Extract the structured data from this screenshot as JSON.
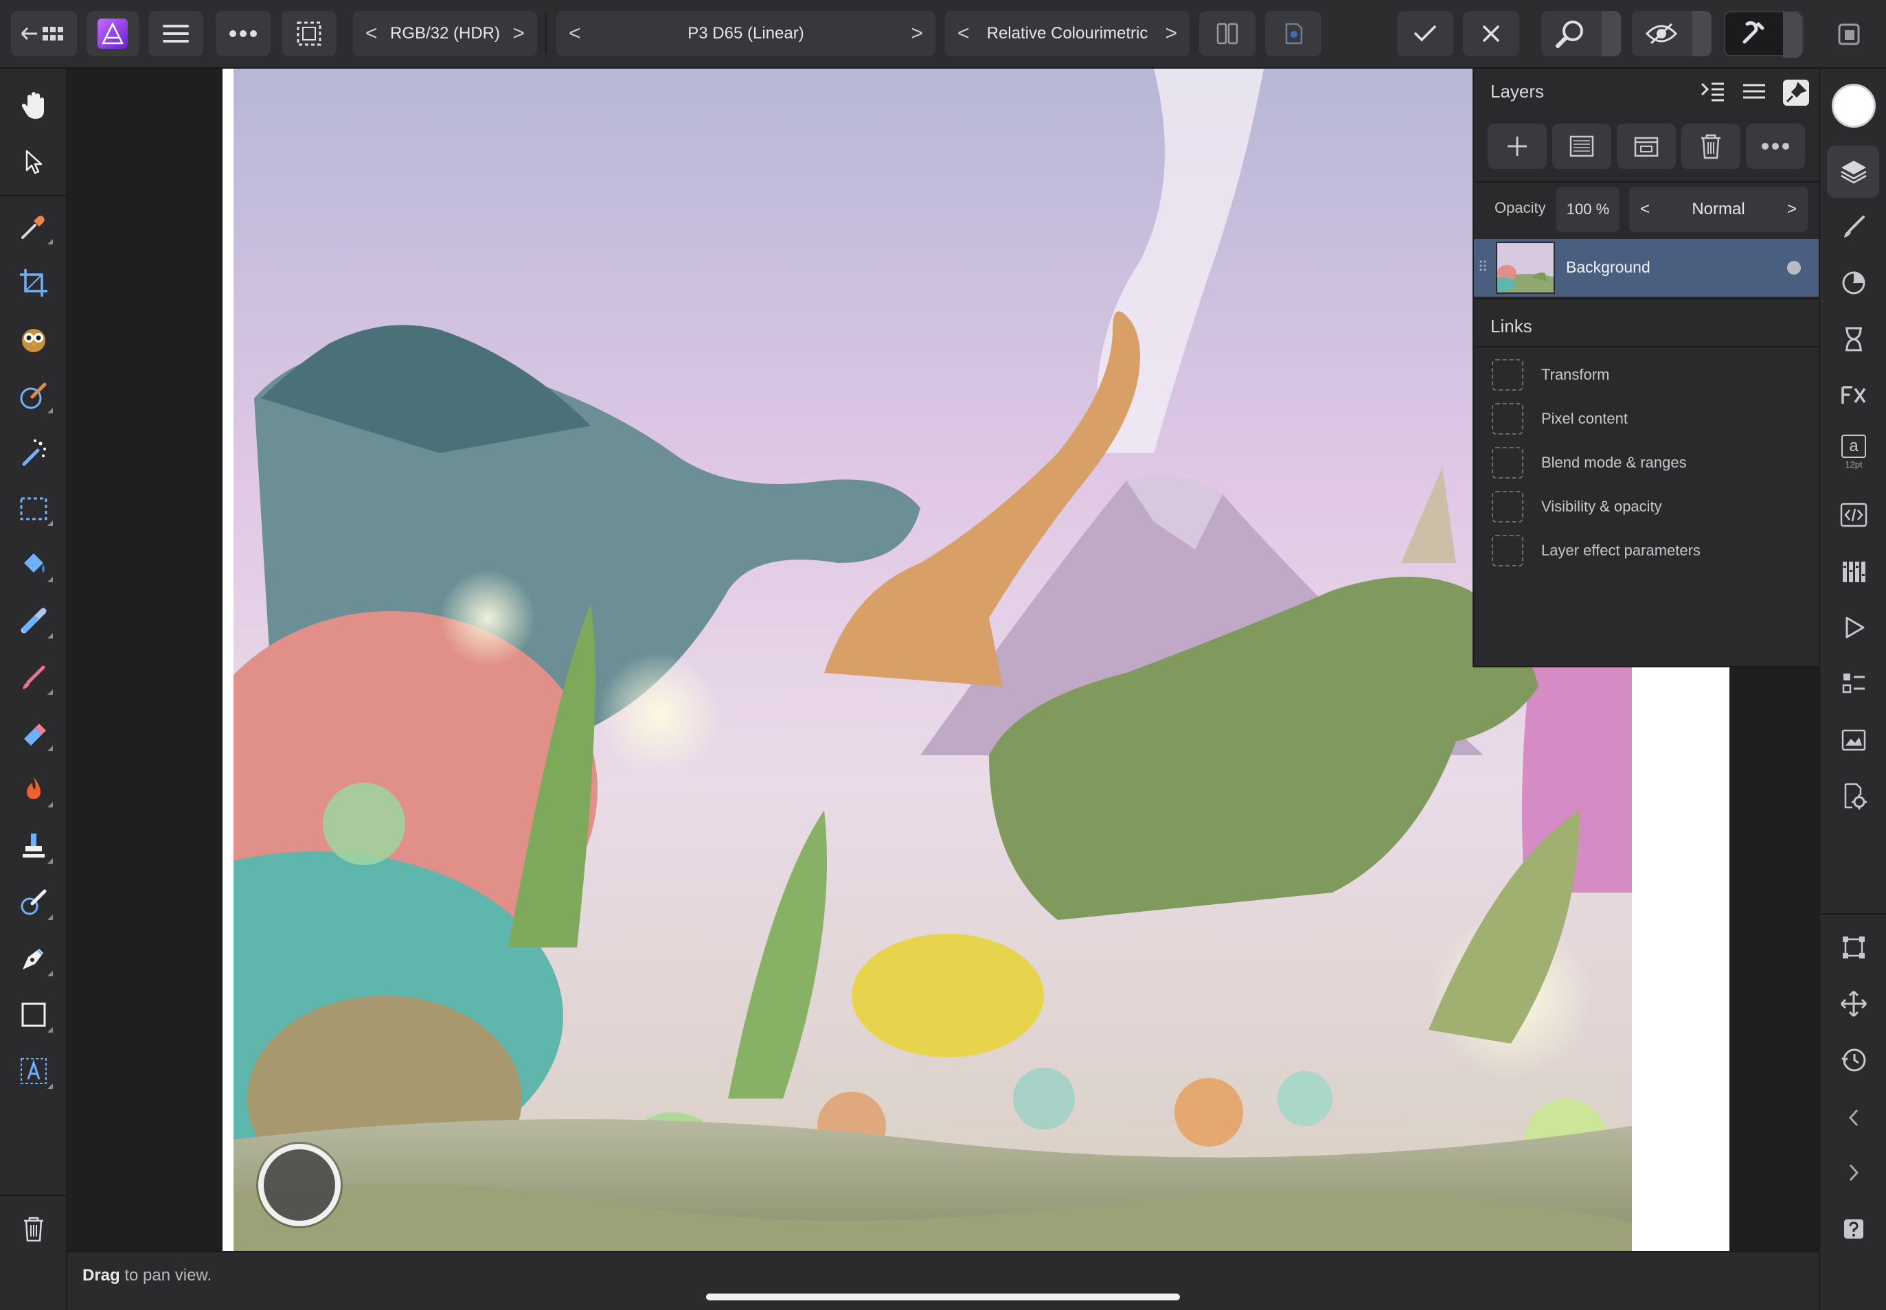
{
  "toolbar": {
    "colour_format": "RGB/32 (HDR)",
    "colour_profile": "P3 D65 (Linear)",
    "rendering_intent": "Relative Colourimetric",
    "prev_arrow": "<",
    "next_arrow": ">"
  },
  "layers": {
    "title": "Layers",
    "opacity_label": "Opacity",
    "opacity_value": "100 %",
    "blend_mode": "Normal",
    "items": [
      {
        "name": "Background"
      }
    ]
  },
  "links": {
    "title": "Links",
    "items": [
      {
        "label": "Transform"
      },
      {
        "label": "Pixel content"
      },
      {
        "label": "Blend mode & ranges"
      },
      {
        "label": "Visibility & opacity"
      },
      {
        "label": "Layer effect parameters"
      }
    ]
  },
  "studio": {
    "text_style_size": "12pt",
    "text_style_letter": "a"
  },
  "status": {
    "bold": "Drag",
    "rest": " to pan view."
  },
  "colors": {
    "accent": "#9b4dff",
    "selected_row": "#4a5f7f",
    "panel_bg": "#2a2a2d"
  }
}
